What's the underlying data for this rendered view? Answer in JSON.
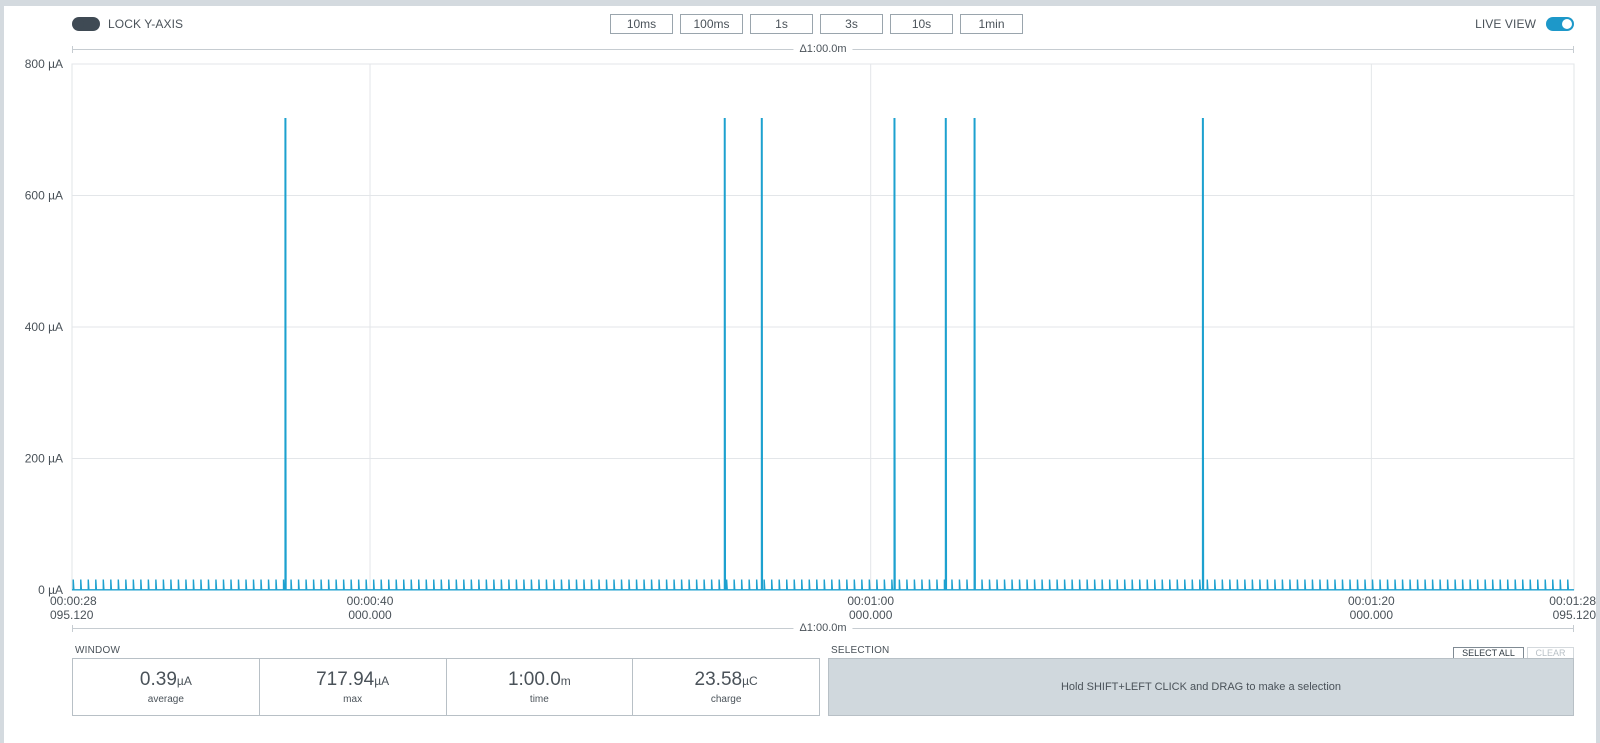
{
  "toolbar": {
    "lock_y_axis_label": "LOCK Y-AXIS",
    "lock_y_axis_on": false,
    "live_view_label": "LIVE VIEW",
    "live_view_on": true,
    "window_buttons": [
      "10ms",
      "100ms",
      "1s",
      "3s",
      "10s",
      "1min"
    ]
  },
  "delta_top": "Δ1:00.0m",
  "delta_bottom": "Δ1:00.0m",
  "colors": {
    "trace": "#1da1cf",
    "toggle_on": "#1d98c9",
    "toggle_off": "#3f4a54",
    "grid": "#e3e6e9"
  },
  "chart_data": {
    "type": "line",
    "ylabel_unit": "µA",
    "ylim": [
      0,
      800
    ],
    "y_ticks": [
      {
        "value": 0,
        "label": "0 µA"
      },
      {
        "value": 200,
        "label": "200 µA"
      },
      {
        "value": 400,
        "label": "400 µA"
      },
      {
        "value": 600,
        "label": "600 µA"
      },
      {
        "value": 800,
        "label": "800 µA"
      }
    ],
    "x_range_seconds": [
      28.09512,
      88.09512
    ],
    "x_ticks": [
      {
        "t": 28.09512,
        "label": "00:00:28",
        "sub": "095.120",
        "align": "start"
      },
      {
        "t": 40,
        "label": "00:00:40",
        "sub": "000.000",
        "align": "middle"
      },
      {
        "t": 60,
        "label": "00:01:00",
        "sub": "000.000",
        "align": "middle"
      },
      {
        "t": 80,
        "label": "00:01:20",
        "sub": "000.000",
        "align": "middle"
      },
      {
        "t": 88.09512,
        "label": "00:01:28",
        "sub": "095.120",
        "align": "end"
      }
    ],
    "x_grid": [
      40,
      60,
      80
    ],
    "baseline_pulse": {
      "period_s": 0.3,
      "amplitude_uA": 16,
      "baseline_uA": 0.3
    },
    "spikes": [
      {
        "t": 36.62,
        "value": 717.94
      },
      {
        "t": 54.17,
        "value": 717.94
      },
      {
        "t": 55.65,
        "value": 717.94
      },
      {
        "t": 60.95,
        "value": 717.94
      },
      {
        "t": 63.0,
        "value": 717.94
      },
      {
        "t": 64.15,
        "value": 717.94
      },
      {
        "t": 73.27,
        "value": 717.94
      }
    ],
    "grid": true
  },
  "window": {
    "section_label": "WINDOW",
    "stats": [
      {
        "value": "0.39",
        "unit": "µA",
        "name": "average"
      },
      {
        "value": "717.94",
        "unit": "µA",
        "name": "max"
      },
      {
        "value": "1:00.0",
        "unit": "m",
        "name": "time"
      },
      {
        "value": "23.58",
        "unit": "µC",
        "name": "charge"
      }
    ]
  },
  "selection": {
    "section_label": "SELECTION",
    "select_all_label": "SELECT ALL",
    "clear_label": "CLEAR",
    "hint": "Hold SHIFT+LEFT CLICK and DRAG to make a selection"
  }
}
